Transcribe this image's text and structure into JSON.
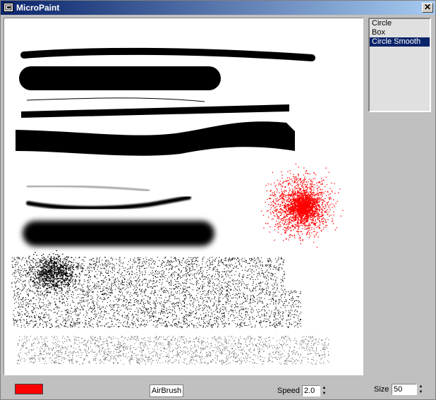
{
  "window": {
    "title": "MicroPaint",
    "close_glyph": "✕"
  },
  "brushes": {
    "items": [
      "Circle",
      "Box",
      "Circle Smooth"
    ],
    "selected_index": 2
  },
  "toolbar": {
    "color": "#ff0000",
    "tool_label": "AirBrush",
    "speed_label": "Speed",
    "speed_value": "2.0",
    "size_label": "Size",
    "size_value": "50"
  },
  "icons": {
    "app": "app-icon",
    "close": "close-icon",
    "spin_up": "spin-up-icon",
    "spin_down": "spin-down-icon"
  },
  "colors": {
    "titlebar_start": "#0a246a",
    "titlebar_end": "#a6caf0",
    "selection": "#0a246a",
    "paint_black": "#000000",
    "paint_red": "#ff0000"
  }
}
